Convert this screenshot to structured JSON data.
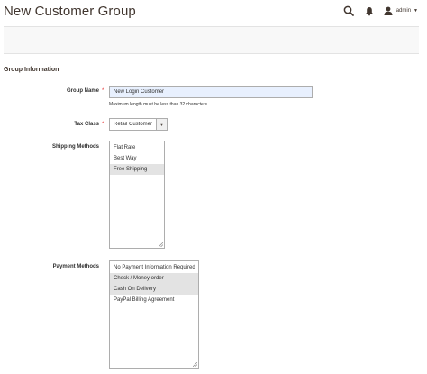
{
  "page": {
    "title": "New Customer Group"
  },
  "header": {
    "account_name": "admin"
  },
  "section": {
    "title": "Group Information"
  },
  "group_name": {
    "label": "Group Name",
    "required_mark": "*",
    "value": "New Login Customer",
    "note": "Maximum length must be less than 32 characters."
  },
  "tax_class": {
    "label": "Tax Class",
    "required_mark": "*",
    "value": "Retail Customer"
  },
  "shipping": {
    "label": "Shipping Methods",
    "options": [
      {
        "label": "Flat Rate",
        "selected": false
      },
      {
        "label": "Best Way",
        "selected": false
      },
      {
        "label": "Free Shipping",
        "selected": true
      }
    ]
  },
  "payment": {
    "label": "Payment Methods",
    "options": [
      {
        "label": "No Payment Information Required",
        "selected": false
      },
      {
        "label": "Check / Money order",
        "selected": true
      },
      {
        "label": "Cash On Delivery",
        "selected": true
      },
      {
        "label": "PayPal Billing Agreement",
        "selected": false
      }
    ]
  },
  "icons": {
    "search": "search-icon",
    "notifications": "bell-icon",
    "user": "user-icon",
    "dropdown": "caret-down-icon",
    "select_arrow": "select-arrow-icon",
    "resize": "resize-grip-icon"
  },
  "colors": {
    "title": "#41362f",
    "required": "#e22626",
    "input_bg": "#e8f0fe",
    "selected_option": "#e3e3e3",
    "border": "#adadad"
  }
}
